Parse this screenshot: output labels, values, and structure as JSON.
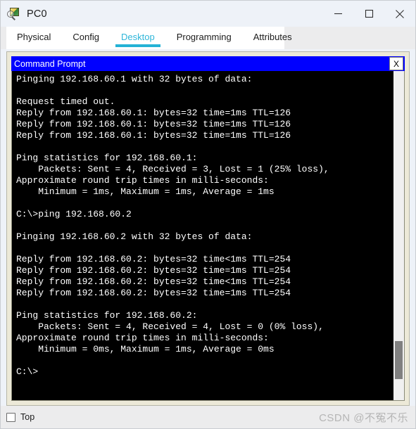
{
  "window": {
    "title": "PC0",
    "icon": "packet-tracer-device-icon",
    "controls": {
      "minimize": "minimize-icon",
      "maximize": "maximize-icon",
      "close": "close-icon"
    }
  },
  "tabs": [
    {
      "label": "Physical",
      "active": false
    },
    {
      "label": "Config",
      "active": false
    },
    {
      "label": "Desktop",
      "active": true
    },
    {
      "label": "Programming",
      "active": false
    },
    {
      "label": "Attributes",
      "active": false
    }
  ],
  "command_prompt": {
    "title": "Command Prompt",
    "close_label": "X",
    "output": "Pinging 192.168.60.1 with 32 bytes of data:\n\nRequest timed out.\nReply from 192.168.60.1: bytes=32 time=1ms TTL=126\nReply from 192.168.60.1: bytes=32 time=1ms TTL=126\nReply from 192.168.60.1: bytes=32 time=1ms TTL=126\n\nPing statistics for 192.168.60.1:\n    Packets: Sent = 4, Received = 3, Lost = 1 (25% loss),\nApproximate round trip times in milli-seconds:\n    Minimum = 1ms, Maximum = 1ms, Average = 1ms\n\nC:\\>ping 192.168.60.2\n\nPinging 192.168.60.2 with 32 bytes of data:\n\nReply from 192.168.60.2: bytes=32 time<1ms TTL=254\nReply from 192.168.60.2: bytes=32 time=1ms TTL=254\nReply from 192.168.60.2: bytes=32 time<1ms TTL=254\nReply from 192.168.60.2: bytes=32 time=1ms TTL=254\n\nPing statistics for 192.168.60.2:\n    Packets: Sent = 4, Received = 4, Lost = 0 (0% loss),\nApproximate round trip times in milli-seconds:\n    Minimum = 0ms, Maximum = 1ms, Average = 0ms\n\nC:\\>",
    "lines": [
      "Pinging 192.168.60.1 with 32 bytes of data:",
      "",
      "Request timed out.",
      "Reply from 192.168.60.1: bytes=32 time=1ms TTL=126",
      "Reply from 192.168.60.1: bytes=32 time=1ms TTL=126",
      "Reply from 192.168.60.1: bytes=32 time=1ms TTL=126",
      "",
      "Ping statistics for 192.168.60.1:",
      "    Packets: Sent = 4, Received = 3, Lost = 1 (25% loss),",
      "Approximate round trip times in milli-seconds:",
      "    Minimum = 1ms, Maximum = 1ms, Average = 1ms",
      "",
      "C:\\>ping 192.168.60.2",
      "",
      "Pinging 192.168.60.2 with 32 bytes of data:",
      "",
      "Reply from 192.168.60.2: bytes=32 time<1ms TTL=254",
      "Reply from 192.168.60.2: bytes=32 time=1ms TTL=254",
      "Reply from 192.168.60.2: bytes=32 time<1ms TTL=254",
      "Reply from 192.168.60.2: bytes=32 time=1ms TTL=254",
      "",
      "Ping statistics for 192.168.60.2:",
      "    Packets: Sent = 4, Received = 4, Lost = 0 (0% loss),",
      "Approximate round trip times in milli-seconds:",
      "    Minimum = 0ms, Maximum = 1ms, Average = 0ms",
      "",
      "C:\\>"
    ]
  },
  "bottom": {
    "top_checkbox_label": "Top",
    "top_checkbox_checked": false,
    "watermark": "CSDN @不冤不乐"
  },
  "colors": {
    "cmd_titlebar": "#0000ff",
    "terminal_bg": "#000000",
    "terminal_fg": "#ffffff",
    "active_tab": "#24b2d6",
    "panel_bg": "#ece9d8"
  }
}
